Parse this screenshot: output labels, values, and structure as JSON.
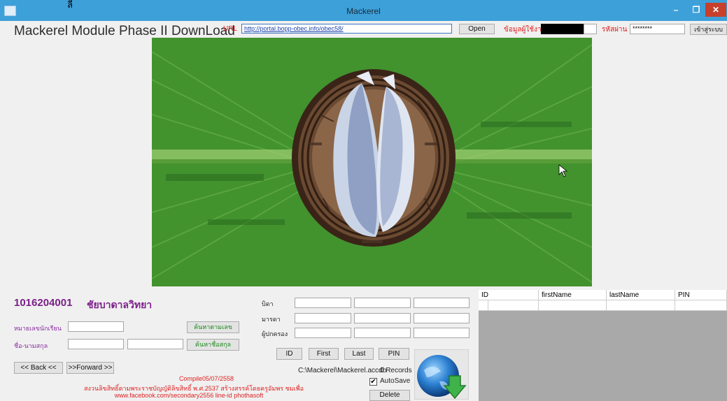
{
  "window": {
    "title": "Mackerel",
    "tiny_glyph": "ลี",
    "min_glyph": "–",
    "max_glyph": "❐",
    "close_glyph": "✕"
  },
  "header": {
    "title": "Mackerel Module Phase II DownLoad",
    "url_label": "URL",
    "url_value": "http://portal.bopp-obec.info/obec58/",
    "open_button": "Open",
    "user_label": "ข้อมูลผู้ใช้งาน",
    "user_value": "",
    "password_label": "รหัสผ่าน",
    "password_value": "********",
    "login_button": "เข้าสู่ระบบ"
  },
  "school": {
    "code": "1016204001",
    "name": "ชัยบาดาลวิทยา"
  },
  "search": {
    "student_id_label": "หมายเลขนักเรียน",
    "name_label": "ชื่อ-นามสกุล",
    "by_number_button": "ค้นหาตามเลข",
    "by_name_button": "ค้นหาชื่อสกุล"
  },
  "nav": {
    "back_button": "<< Back <<",
    "forward_button": ">>Forward >>"
  },
  "parents": {
    "father_label": "บิดา",
    "mother_label": "มารดา",
    "guardian_label": "ผู้ปกครอง"
  },
  "sort_buttons": [
    "ID",
    "First",
    "Last",
    "PIN"
  ],
  "db": {
    "path": "C:\\Mackerel\\Mackerel.accdb",
    "records": "0 Records",
    "autosave_label": "AutoSave",
    "autosave_checked": true,
    "check_glyph": "✔",
    "delete_button": "Delete"
  },
  "credits": {
    "compile": "Compile05/07/2558",
    "copyright": "สงวนลิขสิทธิ์ตามพระราชบัญญัติลิขสิทธิ์ พ.ศ.2537 สร้างสรรค์โดยครูอัมพร ชมเพื่อ",
    "contact": "www.facebook.com/secondary2556 line-id phothasoft"
  },
  "grid": {
    "columns": [
      "ID",
      "firstName",
      "lastName",
      "PIN"
    ]
  },
  "colors": {
    "titlebar": "#3ea0d9",
    "close_red": "#c7402b",
    "accent_purple": "#7b1f8a",
    "label_red": "#dd2222",
    "button_green": "#1a8a1a",
    "leaf_green": "#3e8e2c"
  },
  "icons": {
    "app": "app-icon",
    "download": "globe-download-icon",
    "banner": "fish-in-basket-on-banana-leaf"
  }
}
